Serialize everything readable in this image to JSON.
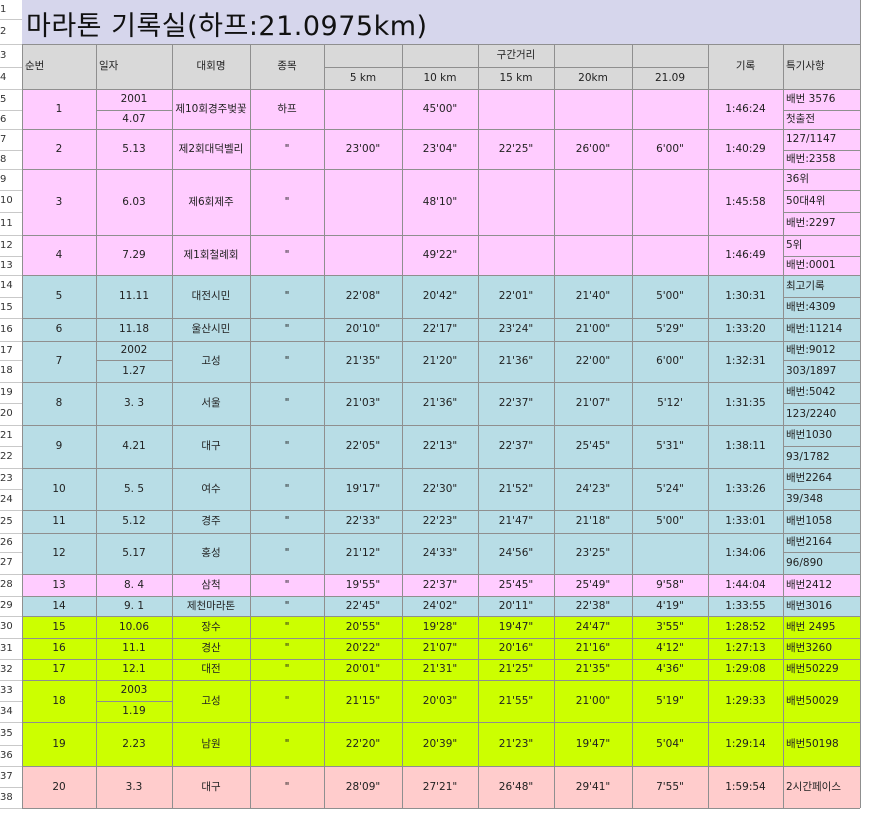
{
  "sheet": {
    "title": "마라톤 기록실(하프:21.0975km)",
    "row_numbers": [
      "1",
      "2",
      "3",
      "4",
      "5",
      "6",
      "7",
      "8",
      "9",
      "10",
      "11",
      "12",
      "13",
      "14",
      "15",
      "16",
      "17",
      "18",
      "19",
      "20",
      "21",
      "22",
      "23",
      "24",
      "25",
      "26",
      "27",
      "28",
      "29",
      "30",
      "31",
      "32",
      "33",
      "34",
      "35",
      "36",
      "37",
      "38"
    ],
    "header": {
      "num": "순번",
      "date": "일자",
      "event": "대회명",
      "category": "종목",
      "section": "구간거리",
      "splits": [
        "5 km",
        "10 km",
        "15 km",
        "20km",
        "21.09"
      ],
      "record": "기록",
      "notes": "특기사항"
    },
    "records": [
      {
        "num": "1",
        "date": [
          "2001",
          "4.07"
        ],
        "event": "제10회경주벚꽃",
        "category": "하프",
        "splits": [
          "",
          "45'00\"",
          "",
          "",
          ""
        ],
        "record": "1:46:24",
        "notes": [
          "배번 3576",
          "첫출전"
        ]
      },
      {
        "num": "2",
        "date": [
          "5.13"
        ],
        "event": "제2회대덕벨리",
        "category": "\"",
        "splits": [
          "23'00\"",
          "23'04\"",
          "22'25\"",
          "26'00\"",
          "6'00\""
        ],
        "record": "1:40:29",
        "notes": [
          "127/1147",
          "배번:2358"
        ]
      },
      {
        "num": "3",
        "date": [
          "6.03"
        ],
        "event": "제6회제주",
        "category": "\"",
        "splits": [
          "",
          "48'10\"",
          "",
          "",
          ""
        ],
        "record": "1:45:58",
        "notes": [
          "36위",
          "50대4위",
          "배번:2297"
        ]
      },
      {
        "num": "4",
        "date": [
          "7.29"
        ],
        "event": "제1회철례회",
        "category": "\"",
        "splits": [
          "",
          "49'22\"",
          "",
          "",
          ""
        ],
        "record": "1:46:49",
        "notes": [
          "5위",
          "배번:0001"
        ]
      },
      {
        "num": "5",
        "date": [
          "11.11"
        ],
        "event": "대전시민",
        "category": "\"",
        "splits": [
          "22'08\"",
          "20'42\"",
          "22'01\"",
          "21'40\"",
          "5'00\""
        ],
        "record": "1:30:31",
        "notes": [
          "최고기록",
          "배번:4309"
        ]
      },
      {
        "num": "6",
        "date": [
          "11.18"
        ],
        "event": "울산시민",
        "category": "\"",
        "splits": [
          "20'10\"",
          "22'17\"",
          "23'24\"",
          "21'00\"",
          "5'29\""
        ],
        "record": "1:33:20",
        "notes": [
          "배번:11214"
        ]
      },
      {
        "num": "7",
        "date": [
          "2002",
          "1.27"
        ],
        "event": "고성",
        "category": "\"",
        "splits": [
          "21'35\"",
          "21'20\"",
          "21'36\"",
          "22'00\"",
          "6'00\""
        ],
        "record": "1:32:31",
        "notes": [
          "배번:9012",
          "303/1897"
        ]
      },
      {
        "num": "8",
        "date": [
          "3. 3"
        ],
        "event": "서울",
        "category": "\"",
        "splits": [
          "21'03\"",
          "21'36\"",
          "22'37\"",
          "21'07\"",
          "5'12'"
        ],
        "record": "1:31:35",
        "notes": [
          "배번:5042",
          "123/2240"
        ]
      },
      {
        "num": "9",
        "date": [
          "4.21"
        ],
        "event": "대구",
        "category": "\"",
        "splits": [
          "22'05\"",
          "22'13\"",
          "22'37\"",
          "25'45\"",
          "5'31\""
        ],
        "record": "1:38:11",
        "notes": [
          "배번1030",
          "93/1782"
        ]
      },
      {
        "num": "10",
        "date": [
          "5. 5"
        ],
        "event": "여수",
        "category": "\"",
        "splits": [
          "19'17\"",
          "22'30\"",
          "21'52\"",
          "24'23\"",
          "5'24\""
        ],
        "record": "1:33:26",
        "notes": [
          "배번2264",
          "39/348"
        ]
      },
      {
        "num": "11",
        "date": [
          "5.12"
        ],
        "event": "경주",
        "category": "\"",
        "splits": [
          "22'33\"",
          "22'23\"",
          "21'47\"",
          "21'18\"",
          "5'00\""
        ],
        "record": "1:33:01",
        "notes": [
          "배번1058"
        ]
      },
      {
        "num": "12",
        "date": [
          "5.17"
        ],
        "event": "홍성",
        "category": "\"",
        "splits": [
          "21'12\"",
          "24'33\"",
          "24'56\"",
          "23'25\"",
          ""
        ],
        "record": "1:34:06",
        "notes": [
          "배번2164",
          "96/890"
        ]
      },
      {
        "num": "13",
        "date": [
          "8. 4"
        ],
        "event": "삼척",
        "category": "\"",
        "splits": [
          "19'55\"",
          "22'37\"",
          "25'45\"",
          "25'49\"",
          "9'58\""
        ],
        "record": "1:44:04",
        "notes": [
          "배번2412"
        ]
      },
      {
        "num": "14",
        "date": [
          "9. 1"
        ],
        "event": "제천마라톤",
        "category": "\"",
        "splits": [
          "22'45\"",
          "24'02\"",
          "20'11\"",
          "22'38\"",
          "4'19\""
        ],
        "record": "1:33:55",
        "notes": [
          "배번3016"
        ]
      },
      {
        "num": "15",
        "date": [
          "10.06"
        ],
        "event": "장수",
        "category": "\"",
        "splits": [
          "20'55\"",
          "19'28\"",
          "19'47\"",
          "24'47\"",
          "3'55\""
        ],
        "record": "1:28:52",
        "notes": [
          "배번 2495"
        ]
      },
      {
        "num": "16",
        "date": [
          "11.1"
        ],
        "event": "경산",
        "category": "\"",
        "splits": [
          "20'22\"",
          "21'07\"",
          "20'16\"",
          "21'16\"",
          "4'12\""
        ],
        "record": "1:27:13",
        "notes": [
          "배번3260"
        ]
      },
      {
        "num": "17",
        "date": [
          "12.1"
        ],
        "event": "대전",
        "category": "\"",
        "splits": [
          "20'01\"",
          "21'31\"",
          "21'25\"",
          "21'35\"",
          "4'36\""
        ],
        "record": "1:29:08",
        "notes": [
          "배번50229"
        ]
      },
      {
        "num": "18",
        "date": [
          "2003",
          "1.19"
        ],
        "event": "고성",
        "category": "\"",
        "splits": [
          "21'15\"",
          "20'03\"",
          "21'55\"",
          "21'00\"",
          "5'19\""
        ],
        "record": "1:29:33",
        "notes": [
          "배번50029"
        ]
      },
      {
        "num": "19",
        "date": [
          "2.23"
        ],
        "event": "남원",
        "category": "\"",
        "splits": [
          "22'20\"",
          "20'39\"",
          "21'23\"",
          "19'47\"",
          "5'04\""
        ],
        "record": "1:29:14",
        "notes": [
          "배번50198"
        ]
      },
      {
        "num": "20",
        "date": [
          "3.3"
        ],
        "event": "대구",
        "category": "\"",
        "splits": [
          "28'09\"",
          "27'21\"",
          "26'48\"",
          "29'41\"",
          "7'55\""
        ],
        "record": "1:59:54",
        "notes": [
          "2시간페이스"
        ]
      }
    ],
    "colors": {
      "pink": "#ffccff",
      "blue": "#b8dde6",
      "lime": "#ccff00",
      "salmon": "#ffcccc",
      "title_bg": "#d6d6ec",
      "header_bg": "#d9d9d9",
      "grid": "#8f8f8f"
    },
    "record_colors": [
      "pink",
      "pink",
      "pink",
      "pink",
      "blue",
      "blue",
      "blue",
      "blue",
      "blue",
      "blue",
      "blue",
      "blue",
      "pink",
      "blue",
      "lime",
      "lime",
      "lime",
      "lime",
      "lime",
      "salmon"
    ]
  }
}
